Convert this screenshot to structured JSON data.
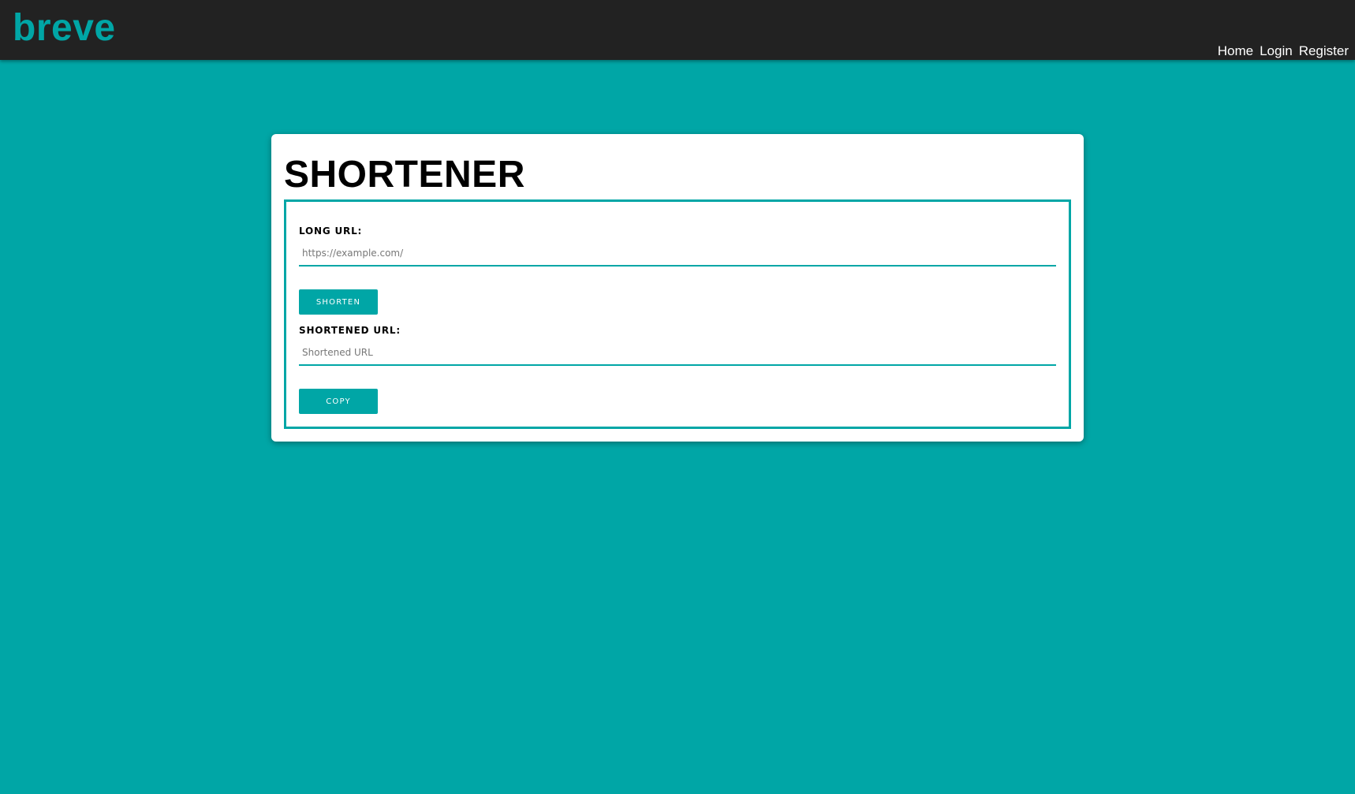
{
  "navbar": {
    "brand": "breve",
    "links": [
      {
        "label": "Home"
      },
      {
        "label": "Login"
      },
      {
        "label": "Register"
      }
    ]
  },
  "shortener": {
    "title": "SHORTENER",
    "long_url": {
      "label": "LONG URL:",
      "placeholder": "https://example.com/",
      "value": ""
    },
    "shorten_button": "SHORTEN",
    "shortened_url": {
      "label": "SHORTENED URL:",
      "placeholder": "Shortened URL",
      "value": ""
    },
    "copy_button": "COPY"
  },
  "colors": {
    "accent": "#00a6a6",
    "navbar_bg": "#222222",
    "card_bg": "#ffffff"
  }
}
